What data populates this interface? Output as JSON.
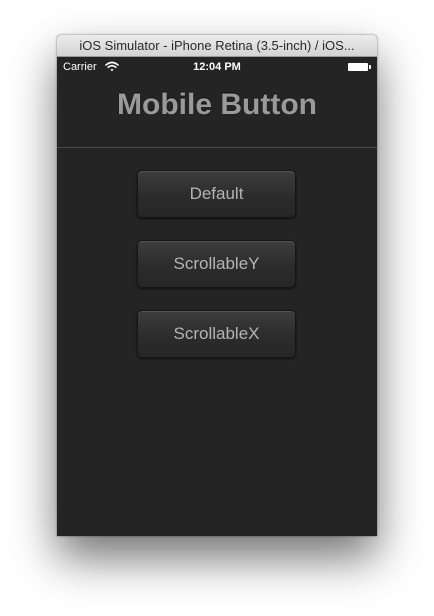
{
  "window": {
    "title": "iOS Simulator - iPhone Retina (3.5-inch) / iOS..."
  },
  "statusbar": {
    "carrier": "Carrier",
    "time": "12:04 PM",
    "wifi_icon": "wifi-icon",
    "battery_icon": "battery-icon"
  },
  "navbar": {
    "title": "Mobile Button"
  },
  "buttons": [
    {
      "label": "Default"
    },
    {
      "label": "ScrollableY"
    },
    {
      "label": "ScrollableX"
    }
  ],
  "colors": {
    "screen_bg": "#242424",
    "title_text": "#9a9a9a",
    "button_text": "#b4b4b4"
  }
}
